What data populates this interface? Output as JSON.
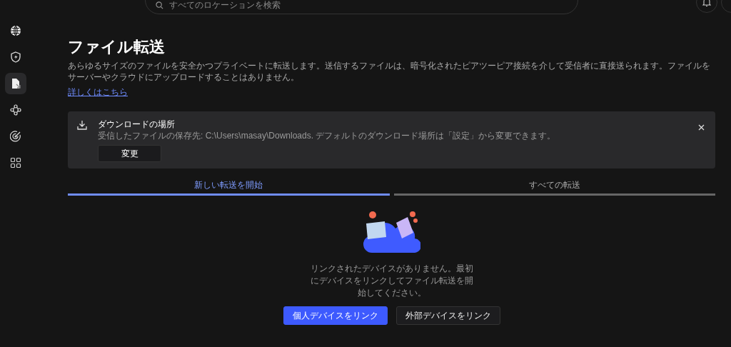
{
  "search": {
    "placeholder": "すべてのロケーションを検索"
  },
  "sidebar": {
    "items": [
      {
        "kind": "globe",
        "selected": false
      },
      {
        "kind": "shield",
        "selected": false
      },
      {
        "kind": "file",
        "selected": true
      },
      {
        "kind": "nodes",
        "selected": false
      },
      {
        "kind": "radar",
        "selected": false
      },
      {
        "kind": "grid",
        "selected": false
      }
    ]
  },
  "page": {
    "title": "ファイル転送",
    "description": "あらゆるサイズのファイルを安全かつプライベートに転送します。送信するファイルは、暗号化されたピアツーピア接続を介して受信者に直接送られます。ファイルをサーバーやクラウドにアップロードすることはありません。",
    "link": "詳しくはこちら"
  },
  "notice": {
    "title": "ダウンロードの場所",
    "text": "受信したファイルの保存先: C:\\Users\\masay\\Downloads. デフォルトのダウンロード場所は「設定」から変更できます。",
    "button": "変更"
  },
  "tabs": [
    {
      "label": "新しい転送を開始",
      "selected": true
    },
    {
      "label": "すべての転送",
      "selected": false
    }
  ],
  "empty": {
    "message": "リンクされたデバイスがありません。最初にデバイスをリンクしてファイル転送を開始してください。",
    "buttons": [
      {
        "label": "個人デバイスをリンク",
        "kind": "primary"
      },
      {
        "label": "外部デバイスをリンク",
        "kind": "secondary"
      }
    ]
  }
}
